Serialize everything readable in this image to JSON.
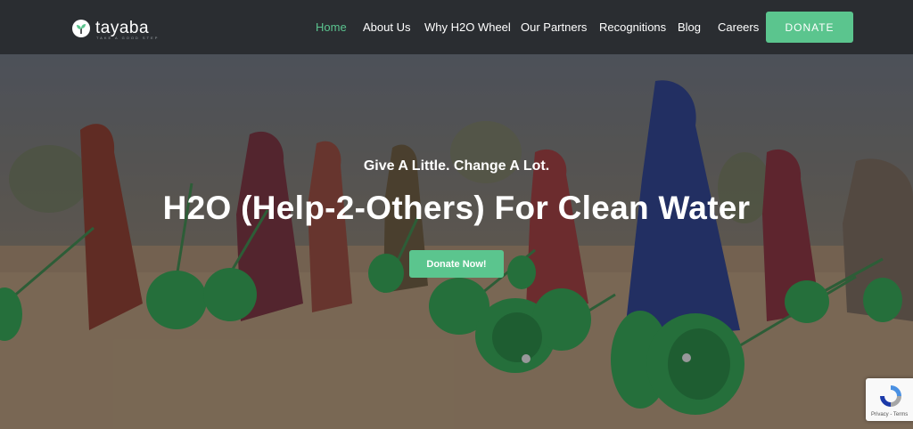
{
  "brand": {
    "name": "tayaba",
    "tagline": "TAKE A GOOD STEP"
  },
  "nav": {
    "items": [
      {
        "label": "Home",
        "active": true
      },
      {
        "label": "About Us",
        "active": false
      },
      {
        "label": "Why H2O Wheel",
        "active": false
      },
      {
        "label": "Our Partners",
        "active": false
      },
      {
        "label": "Recognitions",
        "active": false
      },
      {
        "label": "Blog",
        "active": false
      },
      {
        "label": "Careers",
        "active": false
      }
    ],
    "donate_label": "DONATE"
  },
  "hero": {
    "subtitle": "Give A Little. Change A Lot.",
    "title": "H2O (Help-2-Others) For Clean Water",
    "cta_label": "Donate Now!"
  },
  "recaptcha": {
    "links": "Privacy - Terms"
  },
  "colors": {
    "accent": "#5bc58e",
    "header_bg": "#2a2d31",
    "wheel_green": "#2fa64f"
  }
}
